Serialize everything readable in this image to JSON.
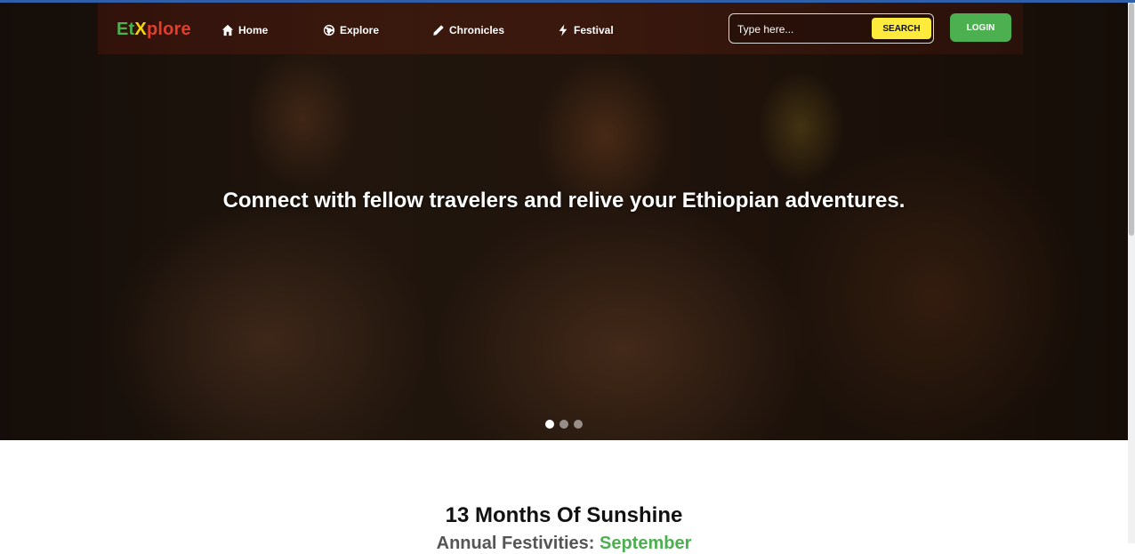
{
  "brand": {
    "part1": "Et",
    "part2": "X",
    "part3": "plore",
    "colors": {
      "green": "#4caf50",
      "yellow": "#f5d50a",
      "red": "#e23d2d"
    }
  },
  "nav": {
    "items": [
      {
        "label": "Home",
        "icon": "home-icon"
      },
      {
        "label": "Explore",
        "icon": "globe-icon"
      },
      {
        "label": "Chronicles",
        "icon": "pencil-icon"
      },
      {
        "label": "Festival",
        "icon": "lightning-icon"
      }
    ]
  },
  "search": {
    "placeholder": "Type here...",
    "button_label": "SEARCH"
  },
  "login": {
    "label": "LOGIN"
  },
  "hero": {
    "headline": "Connect with fellow travelers and relive your Ethiopian adventures.",
    "slides": 3,
    "active_slide": 1
  },
  "section": {
    "title": "13 Months Of Sunshine",
    "subtitle_prefix": "Annual Festivities: ",
    "subtitle_month": "September"
  },
  "colors": {
    "accent_green": "#4caf50",
    "search_yellow": "#ffeb3b"
  }
}
